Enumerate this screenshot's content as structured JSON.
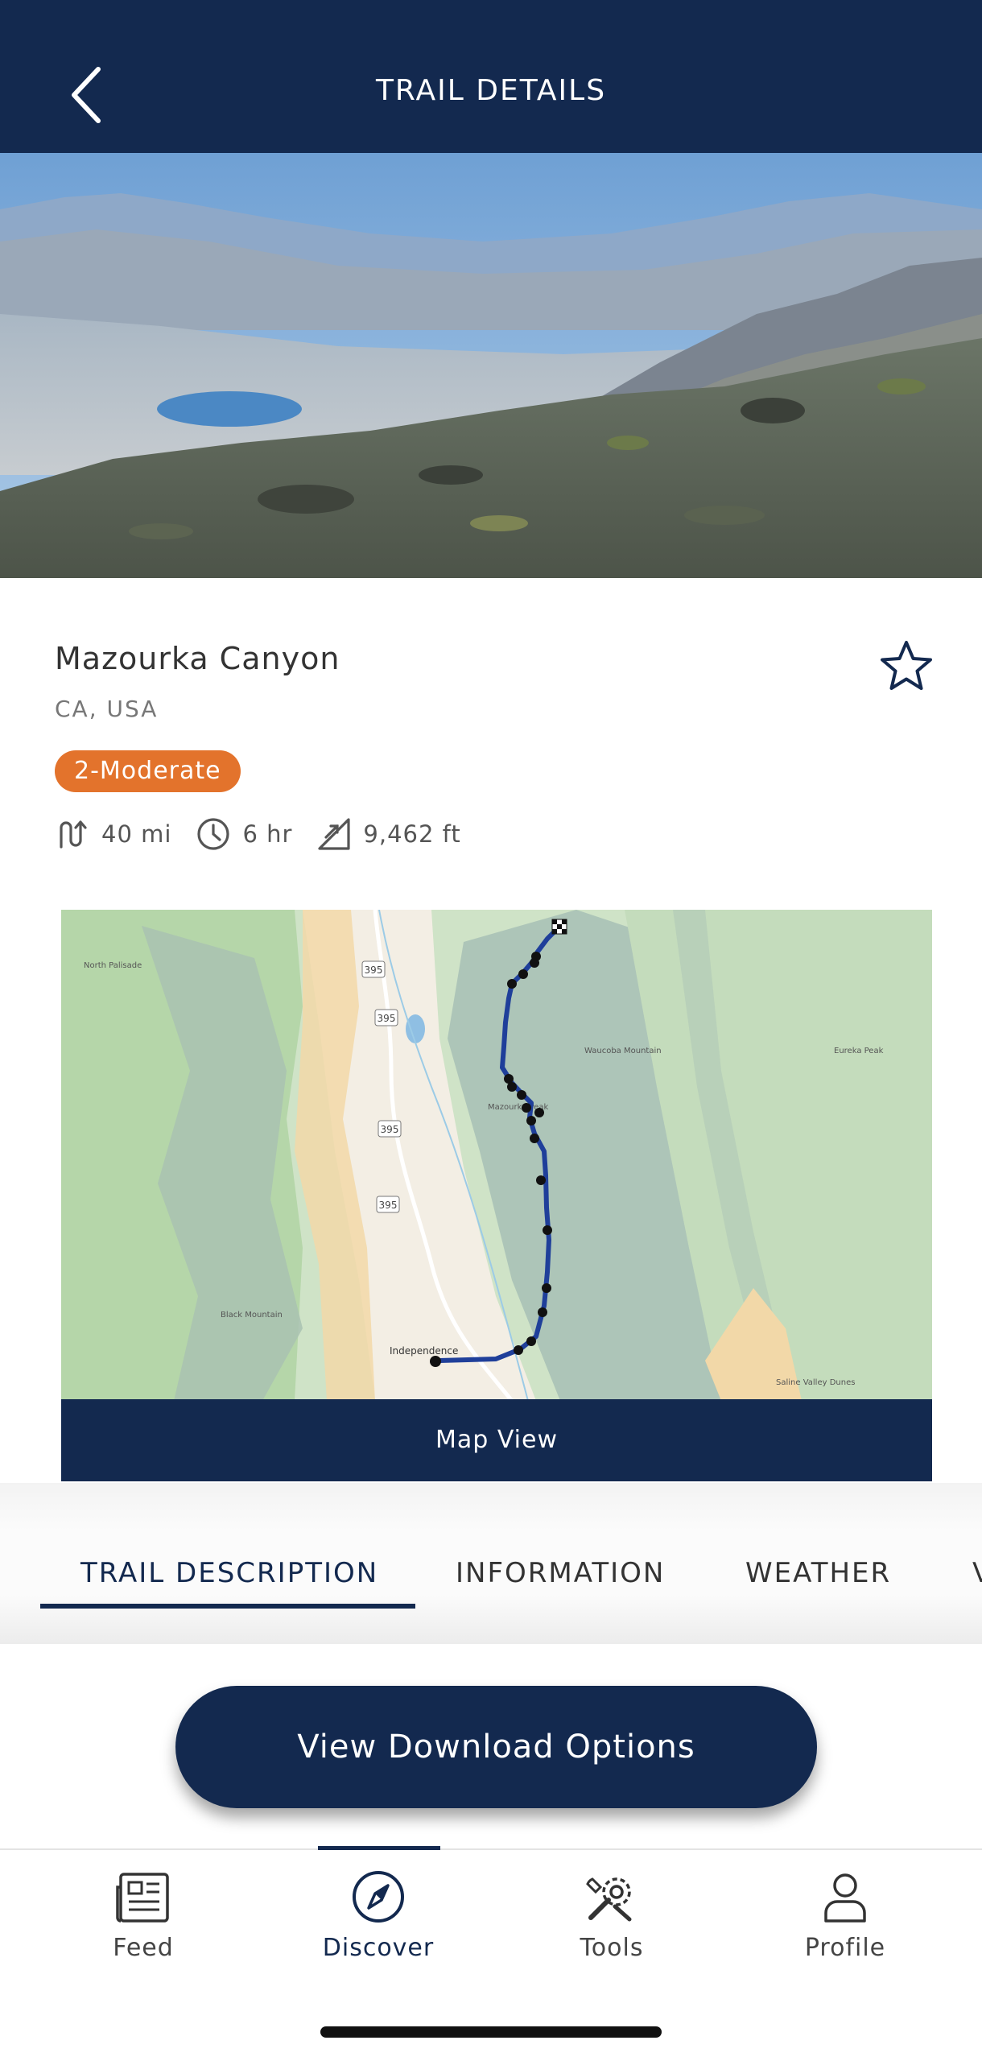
{
  "header": {
    "title": "TRAIL DETAILS",
    "back_icon": "chevron-left-icon"
  },
  "hero": {
    "description": "mountain-lake-landscape"
  },
  "trail": {
    "name": "Mazourka Canyon",
    "location": "CA, USA",
    "difficulty": "2-Moderate",
    "difficulty_color": "#e3732c",
    "distance": "40 mi",
    "duration": "6 hr",
    "elevation": "9,462 ft",
    "favorite_icon": "star-outline-icon"
  },
  "map": {
    "button_label": "Map View",
    "labels": {
      "start_town": "Independence",
      "peak": "Mazourka Peak",
      "mountain": "Waucoba Mountain",
      "eureka_peak": "Eureka Peak",
      "black_mountain": "Black Mountain",
      "north_palisade": "North Palisade",
      "saline": "Saline Valley Dunes",
      "hwy_a": "395",
      "hwy_b": "395",
      "hwy_c": "395",
      "hwy_d": "395"
    }
  },
  "tabs": [
    {
      "label": "TRAIL DESCRIPTION",
      "active": true
    },
    {
      "label": "INFORMATION",
      "active": false
    },
    {
      "label": "WEATHER",
      "active": false
    },
    {
      "label": "V",
      "active": false
    }
  ],
  "cta": {
    "label": "View Download Options"
  },
  "bottom_nav": [
    {
      "label": "Feed",
      "icon": "newspaper-icon",
      "active": false
    },
    {
      "label": "Discover",
      "icon": "compass-icon",
      "active": true
    },
    {
      "label": "Tools",
      "icon": "tools-icon",
      "active": false
    },
    {
      "label": "Profile",
      "icon": "person-icon",
      "active": false
    }
  ],
  "colors": {
    "primary": "#13294f",
    "accent": "#e3732c"
  }
}
